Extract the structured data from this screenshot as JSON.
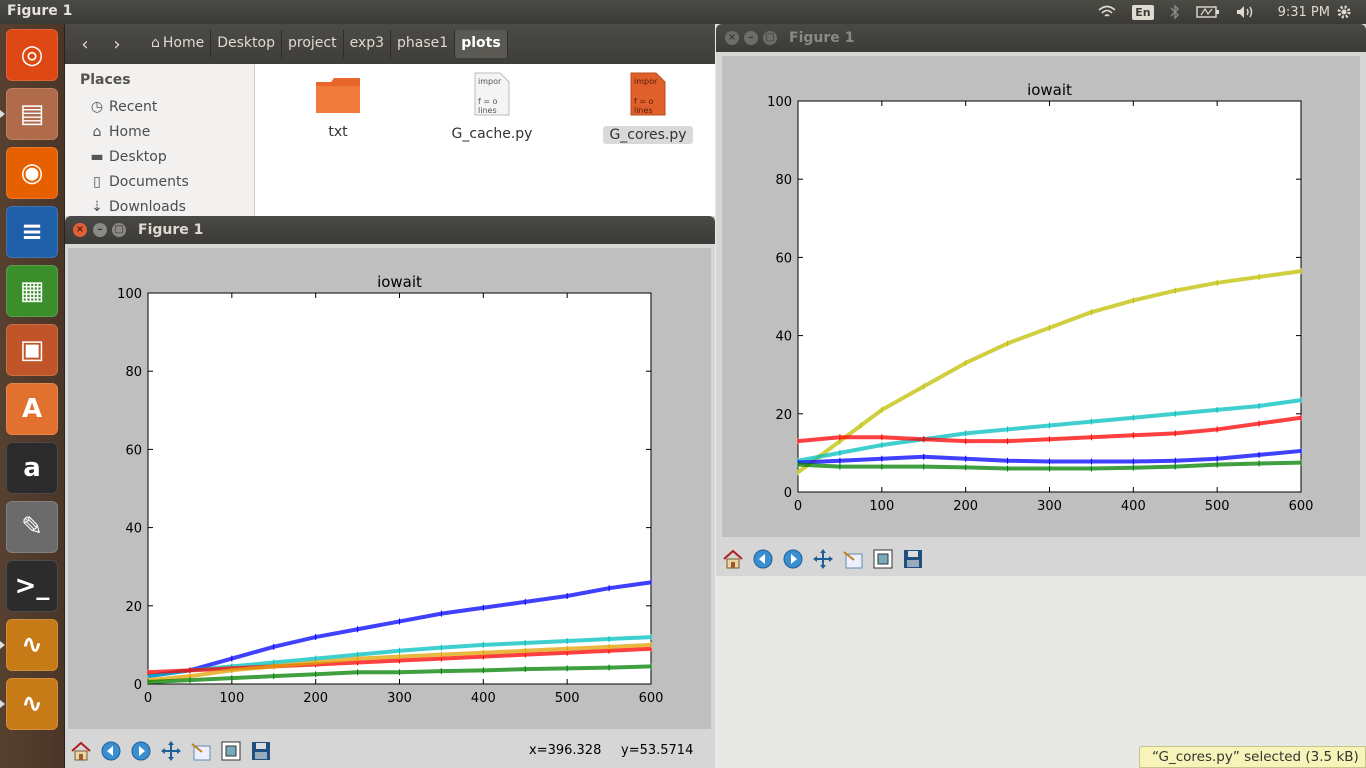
{
  "top_panel": {
    "app_title": "Figure 1",
    "lang": "En",
    "clock": "9:31 PM",
    "icons": [
      "wifi-icon",
      "bluetooth-icon",
      "battery-icon",
      "volume-icon",
      "gear-icon"
    ]
  },
  "launcher": {
    "items": [
      {
        "name": "ubuntu-dash",
        "glyph": "◎",
        "color": "#dd4814"
      },
      {
        "name": "files",
        "glyph": "▤",
        "color": "#b06b4b"
      },
      {
        "name": "firefox",
        "glyph": "◉",
        "color": "#e66000"
      },
      {
        "name": "writer",
        "glyph": "≡",
        "color": "#1f5fa8"
      },
      {
        "name": "calc",
        "glyph": "▦",
        "color": "#3a8f2c"
      },
      {
        "name": "impress",
        "glyph": "▣",
        "color": "#c0552a"
      },
      {
        "name": "software-center",
        "glyph": "A",
        "color": "#e2702e"
      },
      {
        "name": "amazon",
        "glyph": "a",
        "color": "#2b2b2b"
      },
      {
        "name": "system-settings",
        "glyph": "✎",
        "color": "#6b6b6b"
      },
      {
        "name": "terminal",
        "glyph": ">_",
        "color": "#2c2c2c"
      },
      {
        "name": "figure-1",
        "glyph": "∿",
        "color": "#c77b17"
      },
      {
        "name": "figure-2",
        "glyph": "∿",
        "color": "#c77b17"
      }
    ]
  },
  "file_manager": {
    "breadcrumbs": [
      "Home",
      "Desktop",
      "project",
      "exp3",
      "phase1",
      "plots"
    ],
    "sidebar_header": "Places",
    "sidebar_items": [
      {
        "label": "Recent",
        "icon": "clock-icon"
      },
      {
        "label": "Home",
        "icon": "home-icon"
      },
      {
        "label": "Desktop",
        "icon": "folder-icon"
      },
      {
        "label": "Documents",
        "icon": "document-icon"
      },
      {
        "label": "Downloads",
        "icon": "download-icon"
      }
    ],
    "files": [
      {
        "name": "txt",
        "type": "folder"
      },
      {
        "name": "G_cache.py",
        "type": "script",
        "preview": "impor\n\nf = o\nlines"
      },
      {
        "name": "G_cores.py",
        "type": "script",
        "preview": "impor\n\nf = o\nlines",
        "selected": true
      }
    ]
  },
  "figure_front": {
    "window_title": "Figure 1",
    "coords": {
      "x": "x=396.328",
      "y": "y=53.5714"
    }
  },
  "figure_back": {
    "window_title": "Figure 1"
  },
  "toolbar_icons": [
    "home-icon",
    "back-icon",
    "forward-icon",
    "pan-icon",
    "subplots-icon",
    "zoom-icon",
    "save-icon"
  ],
  "status": "“G_cores.py” selected  (3.5 kB)",
  "chart_data": [
    {
      "type": "line",
      "title": "iowait",
      "xlim": [
        0,
        600
      ],
      "ylim": [
        0,
        100
      ],
      "xticks": [
        "0",
        "100",
        "200",
        "300",
        "400",
        "500",
        "600"
      ],
      "yticks": [
        "0",
        "20",
        "40",
        "60",
        "80",
        "100"
      ],
      "grid": false,
      "series": [
        {
          "color": "#0000ff",
          "x": [
            0,
            50,
            100,
            150,
            200,
            250,
            300,
            350,
            400,
            450,
            500,
            550,
            600
          ],
          "values": [
            2,
            3.5,
            6.5,
            9.5,
            12,
            14,
            16,
            18,
            19.5,
            21,
            22.5,
            24.5,
            26
          ]
        },
        {
          "color": "#00bfbf",
          "x": [
            0,
            50,
            100,
            150,
            200,
            250,
            300,
            350,
            400,
            450,
            500,
            550,
            600
          ],
          "values": [
            2,
            3.5,
            4.5,
            5.5,
            6.5,
            7.5,
            8.5,
            9.3,
            10,
            10.5,
            11,
            11.5,
            12
          ]
        },
        {
          "color": "#ff0000",
          "x": [
            0,
            50,
            100,
            150,
            200,
            250,
            300,
            350,
            400,
            450,
            500,
            550,
            600
          ],
          "values": [
            3,
            3.5,
            4,
            4.5,
            5,
            5.5,
            6,
            6.5,
            7,
            7.5,
            8,
            8.5,
            9
          ]
        },
        {
          "color": "#e0a000",
          "x": [
            0,
            50,
            100,
            150,
            200,
            250,
            300,
            350,
            400,
            450,
            500,
            550,
            600
          ],
          "values": [
            1,
            2,
            3.5,
            4.5,
            5.5,
            6.5,
            7,
            7.5,
            8,
            8.5,
            9,
            9.5,
            10
          ]
        },
        {
          "color": "#008000",
          "x": [
            0,
            50,
            100,
            150,
            200,
            250,
            300,
            350,
            400,
            450,
            500,
            550,
            600
          ],
          "values": [
            0.5,
            1,
            1.5,
            2,
            2.5,
            3,
            3,
            3.3,
            3.5,
            3.8,
            4,
            4.2,
            4.5
          ]
        }
      ]
    },
    {
      "type": "line",
      "title": "iowait",
      "xlim": [
        0,
        600
      ],
      "ylim": [
        0,
        100
      ],
      "xticks": [
        "0",
        "100",
        "200",
        "300",
        "400",
        "500",
        "600"
      ],
      "yticks": [
        "0",
        "20",
        "40",
        "60",
        "80",
        "100"
      ],
      "grid": false,
      "series": [
        {
          "color": "#bfbf00",
          "x": [
            0,
            25,
            50,
            75,
            100,
            150,
            200,
            250,
            300,
            350,
            400,
            450,
            500,
            550,
            600
          ],
          "values": [
            5,
            9,
            13,
            17,
            21,
            27,
            33,
            38,
            42,
            46,
            49,
            51.5,
            53.5,
            55,
            56.5
          ]
        },
        {
          "color": "#00bfbf",
          "x": [
            0,
            50,
            100,
            150,
            200,
            250,
            300,
            350,
            400,
            450,
            500,
            550,
            600
          ],
          "values": [
            8,
            10,
            12,
            13.5,
            15,
            16,
            17,
            18,
            19,
            20,
            21,
            22,
            23.5
          ]
        },
        {
          "color": "#ff0000",
          "x": [
            0,
            50,
            100,
            150,
            200,
            250,
            300,
            350,
            400,
            450,
            500,
            550,
            600
          ],
          "values": [
            13,
            14,
            14,
            13.5,
            13,
            13,
            13.5,
            14,
            14.5,
            15,
            16,
            17.5,
            19
          ]
        },
        {
          "color": "#0000ff",
          "x": [
            0,
            50,
            100,
            150,
            200,
            250,
            300,
            350,
            400,
            450,
            500,
            550,
            600
          ],
          "values": [
            7.5,
            8,
            8.5,
            9,
            8.5,
            8,
            7.8,
            7.8,
            7.8,
            8,
            8.5,
            9.5,
            10.5
          ]
        },
        {
          "color": "#008000",
          "x": [
            0,
            50,
            100,
            150,
            200,
            250,
            300,
            350,
            400,
            450,
            500,
            550,
            600
          ],
          "values": [
            7,
            6.5,
            6.5,
            6.5,
            6.3,
            6,
            6,
            6,
            6.2,
            6.5,
            7,
            7.3,
            7.5
          ]
        }
      ]
    }
  ]
}
